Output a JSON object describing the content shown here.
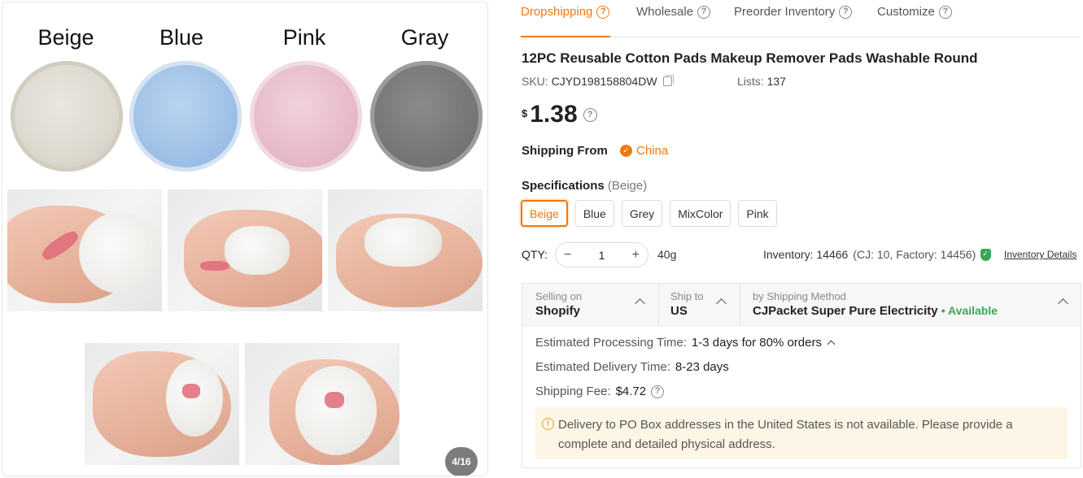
{
  "gallery": {
    "swatches": [
      "Beige",
      "Blue",
      "Pink",
      "Gray"
    ],
    "counter": "4/16"
  },
  "tabs": [
    {
      "label": "Dropshipping",
      "active": true
    },
    {
      "label": "Wholesale",
      "active": false
    },
    {
      "label": "Preorder Inventory",
      "active": false
    },
    {
      "label": "Customize",
      "active": false
    }
  ],
  "product": {
    "title": "12PC Reusable Cotton Pads Makeup Remover Pads Washable Round",
    "sku_label": "SKU:",
    "sku": "CJYD198158804DW",
    "lists_label": "Lists:",
    "lists": "137",
    "currency": "$",
    "price": "1.38"
  },
  "shipping_from": {
    "label": "Shipping From",
    "value": "China"
  },
  "specifications": {
    "label": "Specifications",
    "selected": "(Beige)",
    "options": [
      "Beige",
      "Blue",
      "Grey",
      "MixColor",
      "Pink"
    ],
    "active_index": 0
  },
  "qty": {
    "label": "QTY:",
    "value": "1",
    "minus": "−",
    "plus": "+",
    "weight": "40g",
    "inventory": "Inventory: 14466",
    "inventory_detail": "(CJ: 10, Factory: 14456)",
    "inventory_link": "Inventory Details"
  },
  "shipping": {
    "selling_on_label": "Selling on",
    "selling_on": "Shopify",
    "ship_to_label": "Ship to",
    "ship_to": "US",
    "method_label": "by Shipping Method",
    "method": "CJPacket Super Pure Electricity",
    "availability": "• Available",
    "processing_label": "Estimated Processing Time:",
    "processing": "1-3 days for 80% orders",
    "delivery_label": "Estimated Delivery Time:",
    "delivery": "8-23 days",
    "fee_label": "Shipping Fee:",
    "fee": "$4.72",
    "notice": "Delivery to PO Box addresses in the United States is not available. Please provide a complete and detailed physical address."
  },
  "colors": {
    "accent": "#f1780e",
    "available": "#3aa657",
    "notice_bg": "#fdf6e6"
  }
}
